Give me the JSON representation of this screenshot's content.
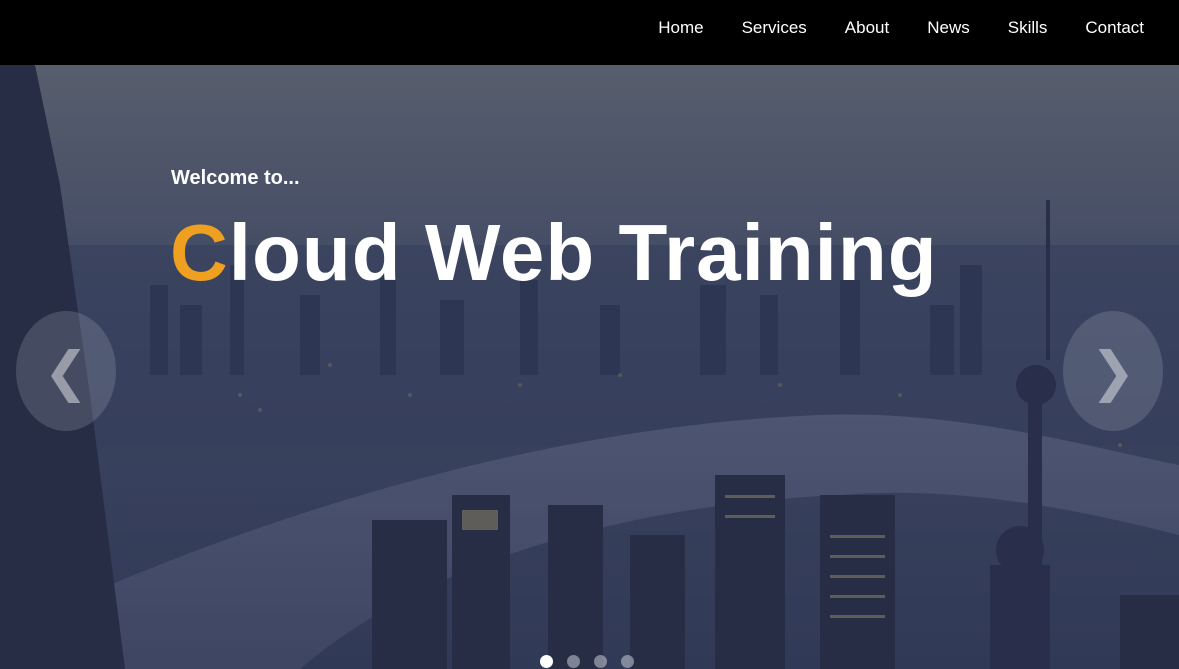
{
  "nav": {
    "items": [
      {
        "label": "Home"
      },
      {
        "label": "Services"
      },
      {
        "label": "About"
      },
      {
        "label": "News"
      },
      {
        "label": "Skills"
      },
      {
        "label": "Contact"
      }
    ]
  },
  "hero": {
    "welcome": "Welcome to...",
    "title_accent_letter": "C",
    "title_rest": "loud Web Training",
    "prev_arrow": "❮",
    "next_arrow": "❯",
    "slide_count": 4,
    "active_slide": 1
  },
  "colors": {
    "accent": "#f0a020",
    "nav_bg": "#000000",
    "text": "#ffffff"
  },
  "icons": {
    "prev": "chevron-left-icon",
    "next": "chevron-right-icon"
  }
}
